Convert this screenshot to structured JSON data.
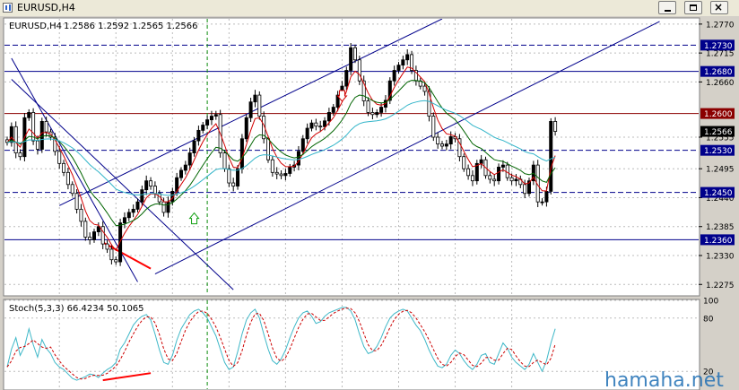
{
  "window": {
    "title": "EURUSD,H4",
    "icon": "chart-window-icon",
    "buttons": [
      "minimize-icon",
      "maximize-icon",
      "close-icon"
    ]
  },
  "main_panel": {
    "symbol_label": "EURUSD,H4",
    "ohlc_label": "1.2586 1.2592 1.2565 1.2566"
  },
  "stoch_panel": {
    "label": "Stoch(5,3,3) 66.4234 50.1065",
    "ylim": [
      0,
      100
    ],
    "ticks": [
      "100",
      "80",
      "20"
    ],
    "tick_values": [
      100,
      80,
      20
    ]
  },
  "watermark": "hamaha.net",
  "colors": {
    "background": "#ffffff",
    "bull_candle": "#000000",
    "ma_fast": "#d20000",
    "ma_mid": "#006400",
    "ma_slow": "#33b5c9",
    "channel": "#00008b",
    "hline_blue": "#00008b",
    "hline_red": "#8b0000",
    "divergence": "#ff0000",
    "stoch_main": "#3fb8c8",
    "stoch_signal": "#cc0000",
    "watermark": "#1f6fb4",
    "grid": "#bcbcbc"
  },
  "chart_data": {
    "type": "candlestick",
    "symbol": "EURUSD",
    "timeframe": "H4",
    "ylim": [
      1.2255,
      1.278
    ],
    "y_ticks": [
      "1.2770",
      "1.2715",
      "1.2660",
      "1.2555",
      "1.2495",
      "1.2440",
      "1.2385",
      "1.2330",
      "1.2275"
    ],
    "y_tick_values": [
      1.277,
      1.2715,
      1.266,
      1.2555,
      1.2495,
      1.244,
      1.2385,
      1.233,
      1.2275
    ],
    "price_labels": [
      {
        "text": "1.2730",
        "value": 1.273,
        "style": "navy"
      },
      {
        "text": "1.2680",
        "value": 1.268,
        "style": "navy"
      },
      {
        "text": "1.2600",
        "value": 1.26,
        "style": "red"
      },
      {
        "text": "1.2566",
        "value": 1.2566,
        "style": "black"
      },
      {
        "text": "1.2530",
        "value": 1.253,
        "style": "navy"
      },
      {
        "text": "1.2450",
        "value": 1.245,
        "style": "navy"
      },
      {
        "text": "1.2360",
        "value": 1.236,
        "style": "navy"
      }
    ],
    "horizontal_lines": [
      {
        "value": 1.273,
        "style": "dashed",
        "color": "#00008b"
      },
      {
        "value": 1.268,
        "style": "solid",
        "color": "#00008b"
      },
      {
        "value": 1.26,
        "style": "solid",
        "color": "#8b0000"
      },
      {
        "value": 1.253,
        "style": "dashed",
        "color": "#00008b"
      },
      {
        "value": 1.245,
        "style": "dashed",
        "color": "#00008b"
      },
      {
        "value": 1.236,
        "style": "solid",
        "color": "#00008b"
      }
    ],
    "closes": [
      1.2545,
      1.2575,
      1.2525,
      1.2518,
      1.2592,
      1.2602,
      1.2548,
      1.2532,
      1.2585,
      1.2565,
      1.2555,
      1.2528,
      1.2505,
      1.2488,
      1.2465,
      1.2448,
      1.2418,
      1.2395,
      1.2365,
      1.236,
      1.2375,
      1.2385,
      1.2352,
      1.2342,
      1.2322,
      1.2318,
      1.2392,
      1.2402,
      1.2412,
      1.2418,
      1.2432,
      1.2455,
      1.2472,
      1.2462,
      1.2448,
      1.2432,
      1.2412,
      1.2432,
      1.2452,
      1.2478,
      1.2492,
      1.2502,
      1.2525,
      1.2548,
      1.2568,
      1.2578,
      1.2588,
      1.2595,
      1.2598,
      1.2525,
      1.2495,
      1.2468,
      1.2462,
      1.2495,
      1.2552,
      1.2592,
      1.2622,
      1.2635,
      1.2595,
      1.2552,
      1.2512,
      1.2488,
      1.2485,
      1.2482,
      1.2486,
      1.2498,
      1.2502,
      1.2528,
      1.2552,
      1.2572,
      1.2582,
      1.2576,
      1.2575,
      1.2586,
      1.2602,
      1.2612,
      1.2635,
      1.2652,
      1.2682,
      1.2725,
      1.2702,
      1.2662,
      1.2624,
      1.2602,
      1.2598,
      1.2602,
      1.2612,
      1.2625,
      1.2662,
      1.2682,
      1.2692,
      1.2702,
      1.2712,
      1.2682,
      1.2662,
      1.2652,
      1.2642,
      1.2595,
      1.2555,
      1.2542,
      1.2538,
      1.2542,
      1.2556,
      1.2552,
      1.2518,
      1.2495,
      1.2482,
      1.2472,
      1.2505,
      1.2512,
      1.2482,
      1.2475,
      1.2472,
      1.2498,
      1.2502,
      1.2478,
      1.2472,
      1.2475,
      1.2465,
      1.2448,
      1.2472,
      1.2502,
      1.2432,
      1.2432,
      1.2452,
      1.2585,
      1.2566
    ],
    "series": [
      {
        "name": "fast moving average",
        "color": "#d20000",
        "period": 5
      },
      {
        "name": "mid moving average",
        "color": "#006400",
        "period": 13
      },
      {
        "name": "slow moving average",
        "color": "#33b5c9",
        "period": 34
      }
    ],
    "channel_lines": [
      {
        "from": {
          "bar": 12,
          "price": 1.2425
        },
        "to": {
          "bar": 100,
          "price": 1.278
        }
      },
      {
        "from": {
          "bar": 34,
          "price": 1.2295
        },
        "to": {
          "bar": 150,
          "price": 1.2775
        }
      },
      {
        "from": {
          "bar": 1,
          "price": 1.2705
        },
        "to": {
          "bar": 30,
          "price": 1.228
        }
      },
      {
        "from": {
          "bar": 1,
          "price": 1.2665
        },
        "to": {
          "bar": 52,
          "price": 1.2265
        }
      }
    ],
    "vertical_marker_bar": 46,
    "arrows": [
      {
        "type": "sell",
        "bar": 77,
        "price": 1.263
      },
      {
        "type": "buy",
        "bar": 43,
        "price": 1.2404
      }
    ],
    "divergence_line": {
      "from": {
        "bar": 22,
        "price": 1.2355
      },
      "to": {
        "bar": 33,
        "price": 1.2305
      }
    },
    "stoch_main": [
      25,
      45,
      58,
      38,
      48,
      68,
      50,
      36,
      56,
      46,
      40,
      30,
      25,
      22,
      17,
      12,
      10,
      12,
      14,
      17,
      16,
      13,
      18,
      22,
      25,
      30,
      45,
      52,
      62,
      72,
      78,
      82,
      84,
      78,
      62,
      44,
      30,
      28,
      38,
      55,
      68,
      76,
      84,
      88,
      90,
      86,
      80,
      70,
      60,
      45,
      30,
      22,
      25,
      42,
      62,
      78,
      86,
      90,
      80,
      62,
      45,
      32,
      28,
      34,
      44,
      58,
      70,
      80,
      86,
      88,
      82,
      74,
      76,
      82,
      86,
      88,
      90,
      92,
      92,
      88,
      78,
      62,
      48,
      40,
      42,
      48,
      58,
      70,
      80,
      85,
      88,
      90,
      88,
      80,
      72,
      66,
      56,
      44,
      34,
      26,
      24,
      28,
      38,
      44,
      40,
      32,
      26,
      22,
      28,
      38,
      40,
      30,
      28,
      40,
      52,
      46,
      36,
      30,
      26,
      22,
      28,
      40,
      30,
      20,
      32,
      52,
      68
    ]
  }
}
